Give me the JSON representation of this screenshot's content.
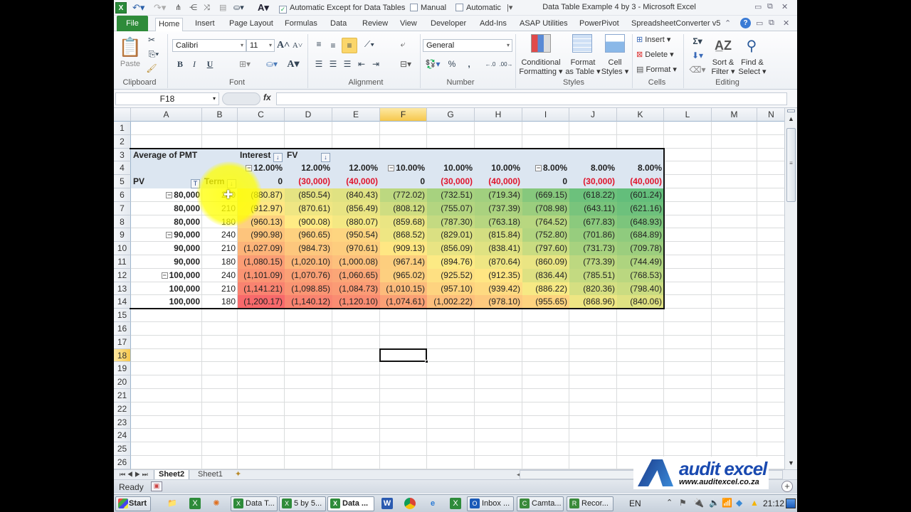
{
  "window": {
    "title": "Data Table Example 4 by 3  -  Microsoft Excel",
    "qat": {
      "calc_auto_except": "Automatic Except for Data Tables",
      "calc_auto_except_checked": true,
      "calc_manual": "Manual",
      "calc_automatic": "Automatic"
    }
  },
  "tabs": [
    "File",
    "Home",
    "Insert",
    "Page Layout",
    "Formulas",
    "Data",
    "Review",
    "View",
    "Developer",
    "Add-Ins",
    "ASAP Utilities",
    "PowerPivot",
    "SpreadsheetConverter v5"
  ],
  "active_tab": "Home",
  "ribbon": {
    "clipboard": {
      "label": "Clipboard",
      "paste": "Paste"
    },
    "font": {
      "label": "Font",
      "name": "Calibri",
      "size": "11",
      "bold": "B",
      "italic": "I",
      "underline": "U"
    },
    "alignment": {
      "label": "Alignment"
    },
    "number": {
      "label": "Number",
      "format": "General",
      "percent": "%",
      "comma": ","
    },
    "styles": {
      "label": "Styles",
      "conditional_1": "Conditional",
      "conditional_2": "Formatting ▾",
      "format_table_1": "Format",
      "format_table_2": "as Table ▾",
      "cell_styles_1": "Cell",
      "cell_styles_2": "Styles ▾"
    },
    "cells": {
      "label": "Cells",
      "insert": "Insert ▾",
      "delete": "Delete ▾",
      "format": "Format ▾"
    },
    "editing": {
      "label": "Editing",
      "sort_1": "Sort &",
      "sort_2": "Filter ▾",
      "find_1": "Find &",
      "find_2": "Select ▾",
      "sigma": "Σ"
    }
  },
  "formula_bar": {
    "name_box": "F18",
    "fx": "fx",
    "value": ""
  },
  "columns": [
    "A",
    "B",
    "C",
    "D",
    "E",
    "F",
    "G",
    "H",
    "I",
    "J",
    "K",
    "L",
    "M",
    "N"
  ],
  "selected_column": "F",
  "rows": [
    "1",
    "2",
    "3",
    "4",
    "5",
    "6",
    "7",
    "8",
    "9",
    "10",
    "11",
    "12",
    "13",
    "14",
    "15",
    "16",
    "17",
    "18",
    "19",
    "20",
    "21",
    "22",
    "23",
    "24",
    "25",
    "26"
  ],
  "selected_row": "18",
  "selected_cell": "F18",
  "pivot": {
    "value_label": "Average of PMT",
    "col_field_1": "Interest",
    "col_field_2": "FV",
    "row_field_1": "PV",
    "row_field_2": "Term",
    "interest_headers": [
      "12.00%",
      "12.00%",
      "12.00%",
      "10.00%",
      "10.00%",
      "10.00%",
      "8.00%",
      "8.00%",
      "8.00%"
    ],
    "fv_headers": [
      "0",
      "(30,000)",
      "(40,000)",
      "0",
      "(30,000)",
      "(40,000)",
      "0",
      "(30,000)",
      "(40,000)"
    ],
    "rows": [
      {
        "pv": "80,000",
        "term": "240",
        "group": true,
        "values": [
          "(880.87)",
          "(850.54)",
          "(840.43)",
          "(772.02)",
          "(732.51)",
          "(719.34)",
          "(669.15)",
          "(618.22)",
          "(601.24)"
        ]
      },
      {
        "pv": "80,000",
        "term": "210",
        "group": false,
        "values": [
          "(912.97)",
          "(870.61)",
          "(856.49)",
          "(808.12)",
          "(755.07)",
          "(737.39)",
          "(708.98)",
          "(643.11)",
          "(621.16)"
        ]
      },
      {
        "pv": "80,000",
        "term": "180",
        "group": false,
        "values": [
          "(960.13)",
          "(900.08)",
          "(880.07)",
          "(859.68)",
          "(787.30)",
          "(763.18)",
          "(764.52)",
          "(677.83)",
          "(648.93)"
        ]
      },
      {
        "pv": "90,000",
        "term": "240",
        "group": true,
        "values": [
          "(990.98)",
          "(960.65)",
          "(950.54)",
          "(868.52)",
          "(829.01)",
          "(815.84)",
          "(752.80)",
          "(701.86)",
          "(684.89)"
        ]
      },
      {
        "pv": "90,000",
        "term": "210",
        "group": false,
        "values": [
          "(1,027.09)",
          "(984.73)",
          "(970.61)",
          "(909.13)",
          "(856.09)",
          "(838.41)",
          "(797.60)",
          "(731.73)",
          "(709.78)"
        ]
      },
      {
        "pv": "90,000",
        "term": "180",
        "group": false,
        "values": [
          "(1,080.15)",
          "(1,020.10)",
          "(1,000.08)",
          "(967.14)",
          "(894.76)",
          "(870.64)",
          "(860.09)",
          "(773.39)",
          "(744.49)"
        ]
      },
      {
        "pv": "100,000",
        "term": "240",
        "group": true,
        "values": [
          "(1,101.09)",
          "(1,070.76)",
          "(1,060.65)",
          "(965.02)",
          "(925.52)",
          "(912.35)",
          "(836.44)",
          "(785.51)",
          "(768.53)"
        ]
      },
      {
        "pv": "100,000",
        "term": "210",
        "group": false,
        "values": [
          "(1,141.21)",
          "(1,098.85)",
          "(1,084.73)",
          "(1,010.15)",
          "(957.10)",
          "(939.42)",
          "(886.22)",
          "(820.36)",
          "(798.40)"
        ]
      },
      {
        "pv": "100,000",
        "term": "180",
        "group": false,
        "values": [
          "(1,200.17)",
          "(1,140.12)",
          "(1,120.10)",
          "(1,074.61)",
          "(1,002.22)",
          "(978.10)",
          "(955.65)",
          "(868.96)",
          "(840.06)"
        ]
      }
    ],
    "color_scale": {
      "low": "#f8696b",
      "mid": "#ffeb84",
      "high": "#63be7b"
    }
  },
  "sheets": [
    "Sheet2",
    "Sheet1"
  ],
  "active_sheet": "Sheet2",
  "status": {
    "mode": "Ready"
  },
  "logo": {
    "brand": "audit excel",
    "url": "www.auditexcel.co.za"
  },
  "taskbar": {
    "start": "Start",
    "items": [
      "Data T...",
      "5 by 5...",
      "Data ...",
      "Inbox ...",
      "Camta...",
      "Recor..."
    ],
    "active_item": "Data ...",
    "lang": "EN",
    "clock": "21:12"
  }
}
